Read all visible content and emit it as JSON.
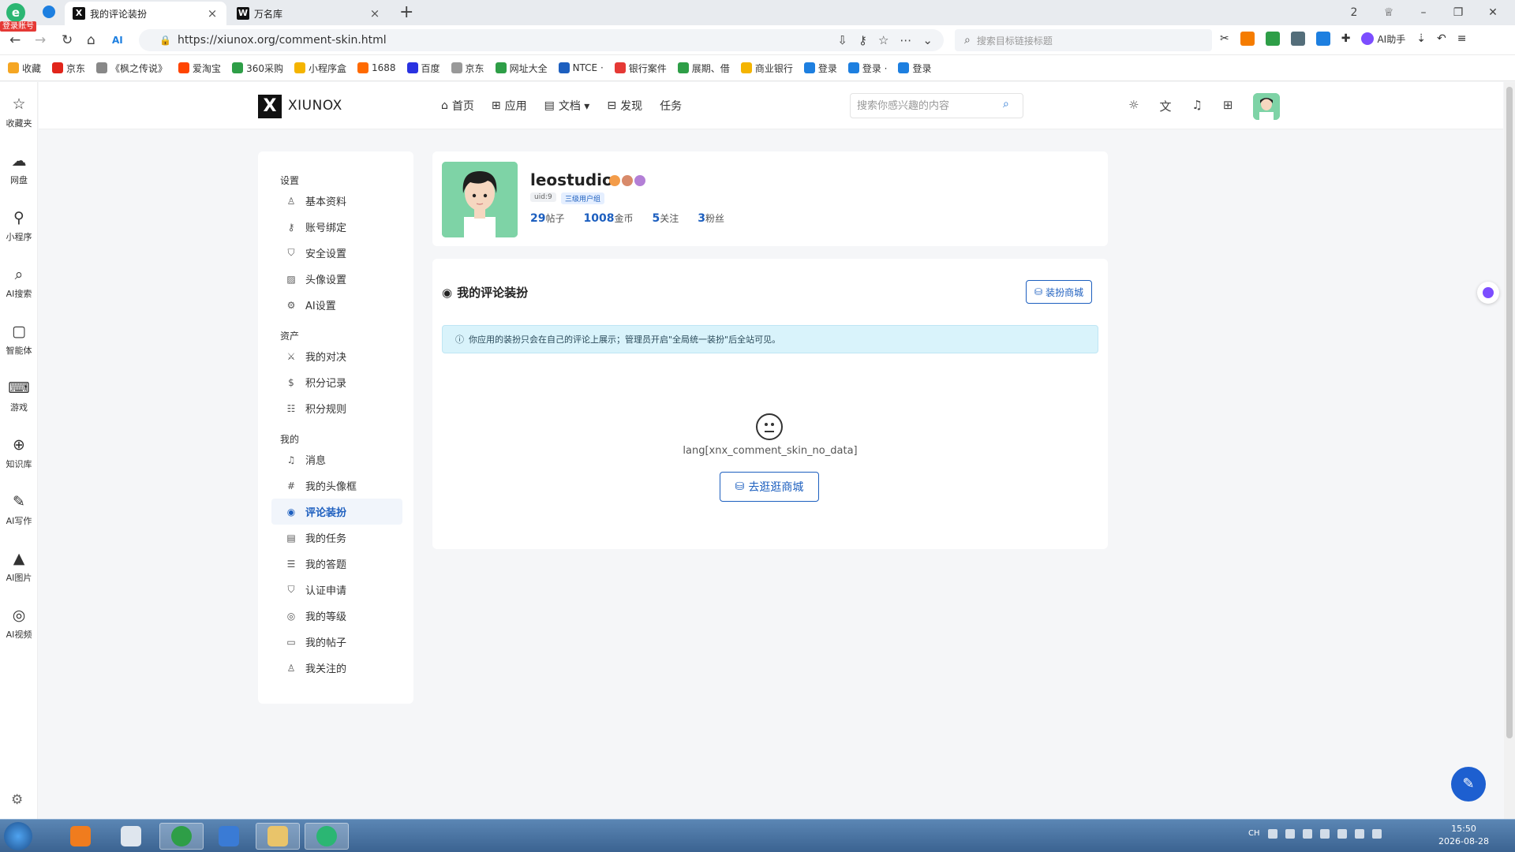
{
  "browser": {
    "login_badge": "登录账号",
    "tabs": [
      {
        "title": "我的评论装扮",
        "favicon": "X"
      },
      {
        "title": "万名库",
        "favicon": "W"
      }
    ],
    "url": "https://xiunox.org/comment-skin.html",
    "search_placeholder": "搜索目标链接标题",
    "ai_helper_label": "AI助手",
    "window_badge": "2"
  },
  "bookmarks": [
    {
      "label": "收藏",
      "color": "#f5a623"
    },
    {
      "label": "京东",
      "color": "#e1251b"
    },
    {
      "label": "《枫之传说》",
      "color": "#888888"
    },
    {
      "label": "爱淘宝",
      "color": "#ff4400"
    },
    {
      "label": "360采购",
      "color": "#2e9e47"
    },
    {
      "label": "小程序盒",
      "color": "#f4b400"
    },
    {
      "label": "1688",
      "color": "#ff6a00"
    },
    {
      "label": "百度",
      "color": "#2932e1"
    },
    {
      "label": "京东",
      "color": "#999999"
    },
    {
      "label": "网址大全",
      "color": "#2e9e47"
    },
    {
      "label": "NTCE ·",
      "color": "#1d5fbf"
    },
    {
      "label": "银行案件",
      "color": "#e53935"
    },
    {
      "label": "展期、借",
      "color": "#2e9e47"
    },
    {
      "label": "商业银行",
      "color": "#f4b400"
    },
    {
      "label": "登录",
      "color": "#1d7fe0"
    },
    {
      "label": "登录 ·",
      "color": "#1d7fe0"
    },
    {
      "label": "登录",
      "color": "#1d7fe0"
    }
  ],
  "rail": [
    {
      "label": "收藏夹",
      "icon": "☆",
      "icon_name": "star-icon"
    },
    {
      "label": "网盘",
      "icon": "☁",
      "icon_name": "cloud-icon"
    },
    {
      "label": "小程序",
      "icon": "⚲",
      "icon_name": "mini-program-icon"
    },
    {
      "label": "AI搜索",
      "icon": "⌕",
      "icon_name": "search-icon"
    },
    {
      "label": "智能体",
      "icon": "▢",
      "icon_name": "agent-icon"
    },
    {
      "label": "游戏",
      "icon": "⌨",
      "icon_name": "gamepad-icon"
    },
    {
      "label": "知识库",
      "icon": "⊕",
      "icon_name": "knowledge-icon"
    },
    {
      "label": "AI写作",
      "icon": "✎",
      "icon_name": "ai-write-icon"
    },
    {
      "label": "AI图片",
      "icon": "▲",
      "icon_name": "ai-image-icon"
    },
    {
      "label": "AI视频",
      "icon": "◎",
      "icon_name": "ai-video-icon"
    }
  ],
  "site": {
    "logo_mark": "X",
    "name": "XIUNOX",
    "nav": [
      {
        "label": "首页",
        "icon": "⌂",
        "icon_name": "home-icon"
      },
      {
        "label": "应用",
        "icon": "⊞",
        "icon_name": "apps-icon"
      },
      {
        "label": "文档 ▾",
        "icon": "▤",
        "icon_name": "docs-icon"
      },
      {
        "label": "发现",
        "icon": "⊟",
        "icon_name": "discover-icon"
      },
      {
        "label": "任务",
        "icon": "",
        "icon_name": "task-icon"
      }
    ],
    "search_placeholder": "搜索你感兴趣的内容"
  },
  "sidebar": {
    "groups": [
      {
        "title": "设置",
        "items": [
          {
            "label": "基本资料",
            "icon": "♙",
            "icon_name": "user-icon"
          },
          {
            "label": "账号绑定",
            "icon": "⚷",
            "icon_name": "key-icon"
          },
          {
            "label": "安全设置",
            "icon": "⛉",
            "icon_name": "shield-icon"
          },
          {
            "label": "头像设置",
            "icon": "▨",
            "icon_name": "image-icon"
          },
          {
            "label": "AI设置",
            "icon": "⚙",
            "icon_name": "ai-settings-icon"
          }
        ]
      },
      {
        "title": "资产",
        "items": [
          {
            "label": "我的对决",
            "icon": "⚔",
            "icon_name": "swords-icon"
          },
          {
            "label": "积分记录",
            "icon": "$",
            "icon_name": "coin-icon"
          },
          {
            "label": "积分规则",
            "icon": "☷",
            "icon_name": "rules-icon"
          }
        ]
      },
      {
        "title": "我的",
        "items": [
          {
            "label": "消息",
            "icon": "♫",
            "icon_name": "bell-icon"
          },
          {
            "label": "我的头像框",
            "icon": "#",
            "icon_name": "frame-icon"
          },
          {
            "label": "评论装扮",
            "icon": "◉",
            "icon_name": "palette-icon",
            "active": true
          },
          {
            "label": "我的任务",
            "icon": "▤",
            "icon_name": "task-list-icon"
          },
          {
            "label": "我的答题",
            "icon": "☰",
            "icon_name": "quiz-icon"
          },
          {
            "label": "认证申请",
            "icon": "⛉",
            "icon_name": "verify-icon"
          },
          {
            "label": "我的等级",
            "icon": "◎",
            "icon_name": "level-icon"
          },
          {
            "label": "我的帖子",
            "icon": "▭",
            "icon_name": "post-icon"
          },
          {
            "label": "我关注的",
            "icon": "♙",
            "icon_name": "follow-icon"
          }
        ]
      }
    ]
  },
  "profile": {
    "name": "leostudio",
    "uid": "uid:9",
    "group": "三级用户组",
    "stats": [
      {
        "value": "29",
        "label": "帖子"
      },
      {
        "value": "1008",
        "label": "金币"
      },
      {
        "value": "5",
        "label": "关注"
      },
      {
        "value": "3",
        "label": "粉丝"
      }
    ]
  },
  "main": {
    "title": "我的评论装扮",
    "shop_button": "装扮商城",
    "notice": "你应用的装扮只会在自己的评论上展示；管理员开启\"全局统一装扮\"后全站可见。",
    "empty_text": "lang[xnx_comment_skin_no_data]",
    "go_shop_button": "去逛逛商城"
  },
  "taskbar": {
    "time": "15:50",
    "date": "2026-08-28",
    "lang": "CH"
  }
}
